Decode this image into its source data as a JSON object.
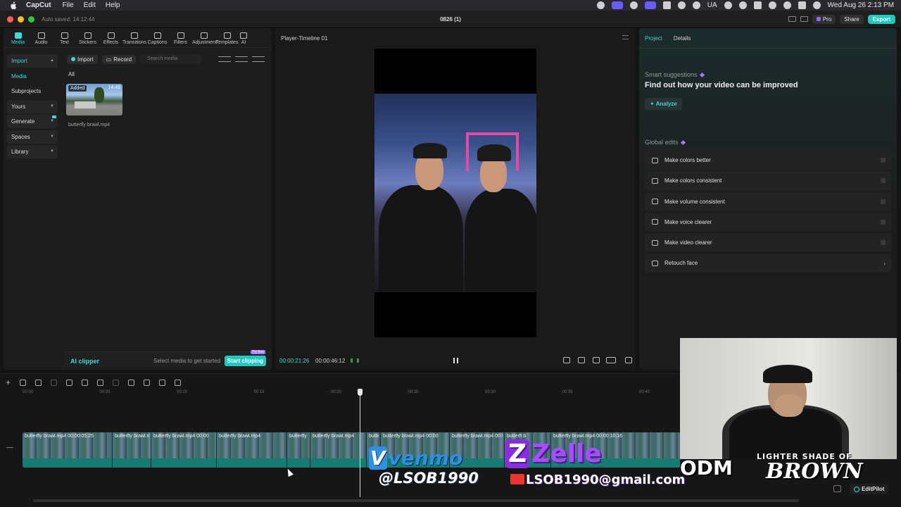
{
  "menubar": {
    "app_name": "CapCut",
    "menus": [
      "File",
      "Edit",
      "Help"
    ],
    "region": "UA",
    "datetime": "Wed Aug 26  2:13 PM"
  },
  "window": {
    "autosave": "Auto saved: 14:12:44",
    "title": "0826 (1)",
    "pro_label": "Pro",
    "share_label": "Share",
    "export_label": "Export"
  },
  "left_panel": {
    "tabs": [
      {
        "label": "Media",
        "active": true
      },
      {
        "label": "Audio"
      },
      {
        "label": "Text"
      },
      {
        "label": "Stickers"
      },
      {
        "label": "Effects"
      },
      {
        "label": "Transitions"
      },
      {
        "label": "Captions"
      },
      {
        "label": "Filters"
      },
      {
        "label": "Adjustment"
      },
      {
        "label": "Templates"
      },
      {
        "label": "AI"
      }
    ],
    "nav": [
      {
        "label": "Import"
      },
      {
        "label": "Media"
      },
      {
        "label": "Subprojects"
      },
      {
        "label": "Yours"
      },
      {
        "label": "Generate"
      },
      {
        "label": "Spaces"
      },
      {
        "label": "Library"
      }
    ],
    "import_label": "Import",
    "record_label": "Record",
    "search_placeholder": "Search media",
    "filter_label": "All",
    "media_item": {
      "badge": "Added",
      "duration": "14:49",
      "filename": "butterfly brawl.mp4"
    },
    "ai_bar": {
      "title": "AI clipper",
      "hint": "Select media to get started",
      "button": "Start clipping",
      "tag": "Try free"
    }
  },
  "player": {
    "title": "Player-Timeline 01",
    "current_time": "00:00:21:26",
    "total_time": "00:00:46:12"
  },
  "right_panel": {
    "tabs": [
      "Project",
      "Details"
    ],
    "smart_label": "Smart suggestions",
    "smart_headline": "Find out how your video can be improved",
    "analyze_label": "Analyze",
    "global_label": "Global edits",
    "edits": [
      {
        "label": "Make colors better",
        "icon": "magic-wand-icon"
      },
      {
        "label": "Make colors consistent",
        "icon": "palette-icon"
      },
      {
        "label": "Make volume consistent",
        "icon": "sliders-icon"
      },
      {
        "label": "Make voice clearer",
        "icon": "waveform-icon"
      },
      {
        "label": "Make video clearer",
        "icon": "hd-icon"
      },
      {
        "label": "Retouch face",
        "icon": "face-icon"
      }
    ]
  },
  "timeline": {
    "ruler": [
      "00:00",
      "00:05",
      "00:10",
      "00:15",
      "00:20",
      "00:25",
      "00:30",
      "00:35",
      "00:40"
    ],
    "clips": [
      {
        "label": "butterfly brawl.mp4   00:00:05:25"
      },
      {
        "label": "butterfly brawl.mp4"
      },
      {
        "label": "butterfly brawl.mp4   00:00"
      },
      {
        "label": "butterfly brawl.mp4"
      },
      {
        "label": "butterfly brawl.mp4"
      },
      {
        "label": "butterfly brawl.mp4"
      },
      {
        "label": "butte"
      },
      {
        "label": "butterfly brawl.mp4   00:00"
      },
      {
        "label": "butterfly brawl.mp4   00:00:05:10"
      },
      {
        "label": "butterfl  b"
      },
      {
        "label": "butterfly brawl.mp4   00:00:10:16"
      }
    ]
  },
  "overlays": {
    "venmo": "venmo",
    "venmo_handle": "@LSOB1990",
    "zelle": "Zelle",
    "zelle_email": "LSOB1990@gmail.com",
    "odm": "ODM",
    "lsob_top": "LIGHTER SHADE OF",
    "lsob_bottom": "BROWN"
  },
  "editpilot_label": "EditPilot"
}
